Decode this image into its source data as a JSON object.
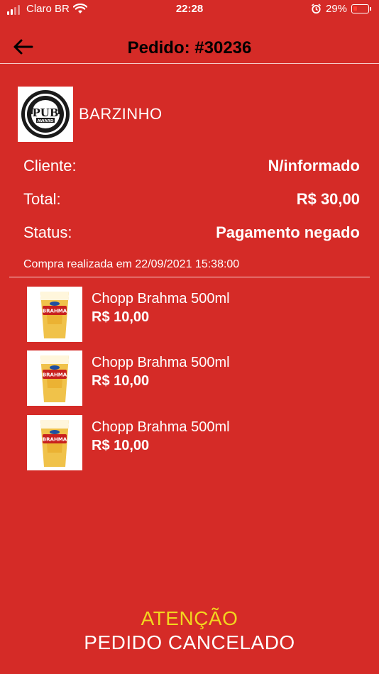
{
  "status_bar": {
    "carrier": "Claro BR",
    "time": "22:28",
    "battery_percent": "29%",
    "battery_level": 0.29,
    "battery_color": "#ff3b30"
  },
  "header": {
    "title": "Pedido: #30236",
    "back_icon": "arrow-left-icon"
  },
  "store": {
    "name": "BARZINHO",
    "logo_icon": "pub-award-logo"
  },
  "info": {
    "client_label": "Cliente:",
    "client_value": "N/informado",
    "total_label": "Total:",
    "total_value": "R$ 30,00",
    "status_label": "Status:",
    "status_value": "Pagamento negado",
    "purchase_date": "Compra realizada em 22/09/2021 15:38:00"
  },
  "items": [
    {
      "name": "Chopp Brahma 500ml",
      "price": "R$ 10,00",
      "icon": "beer-glass-icon"
    },
    {
      "name": "Chopp Brahma 500ml",
      "price": "R$ 10,00",
      "icon": "beer-glass-icon"
    },
    {
      "name": "Chopp Brahma 500ml",
      "price": "R$ 10,00",
      "icon": "beer-glass-icon"
    }
  ],
  "footer": {
    "attention": "ATENÇÃO",
    "cancelled": "PEDIDO CANCELADO"
  },
  "colors": {
    "background": "#d52b27",
    "attention": "#f2d51f",
    "header_title": "#000000"
  }
}
